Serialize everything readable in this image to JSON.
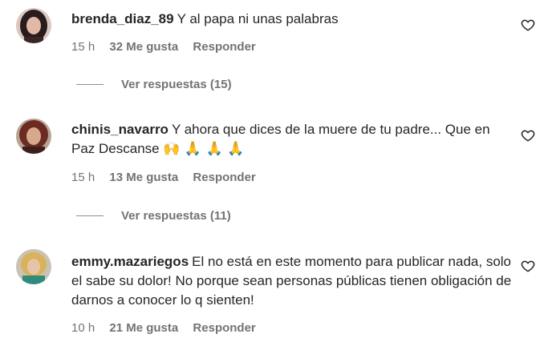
{
  "comments": [
    {
      "username": "brenda_diaz_89",
      "text": "Y al papa ni unas palabras",
      "time": "15 h",
      "likes": "32 Me gusta",
      "reply": "Responder",
      "view_replies": "Ver respuestas (15)"
    },
    {
      "username": "chinis_navarro",
      "text": "Y ahora que dices de la muere de tu padre... Que en Paz Descanse",
      "emojis": "🙌 🙏 🙏 🙏",
      "time": "15 h",
      "likes": "13 Me gusta",
      "reply": "Responder",
      "view_replies": "Ver respuestas (11)"
    },
    {
      "username": "emmy.mazariegos",
      "text": "El no está en este momento para publicar nada, solo el sabe su dolor! No porque sean personas públicas tienen obligación de darnos a conocer lo q sienten!",
      "time": "10 h",
      "likes": "21 Me gusta",
      "reply": "Responder"
    }
  ],
  "colors": {
    "text": "#262626",
    "secondary": "#737373"
  },
  "icons": {
    "like": "heart-outline-icon"
  }
}
